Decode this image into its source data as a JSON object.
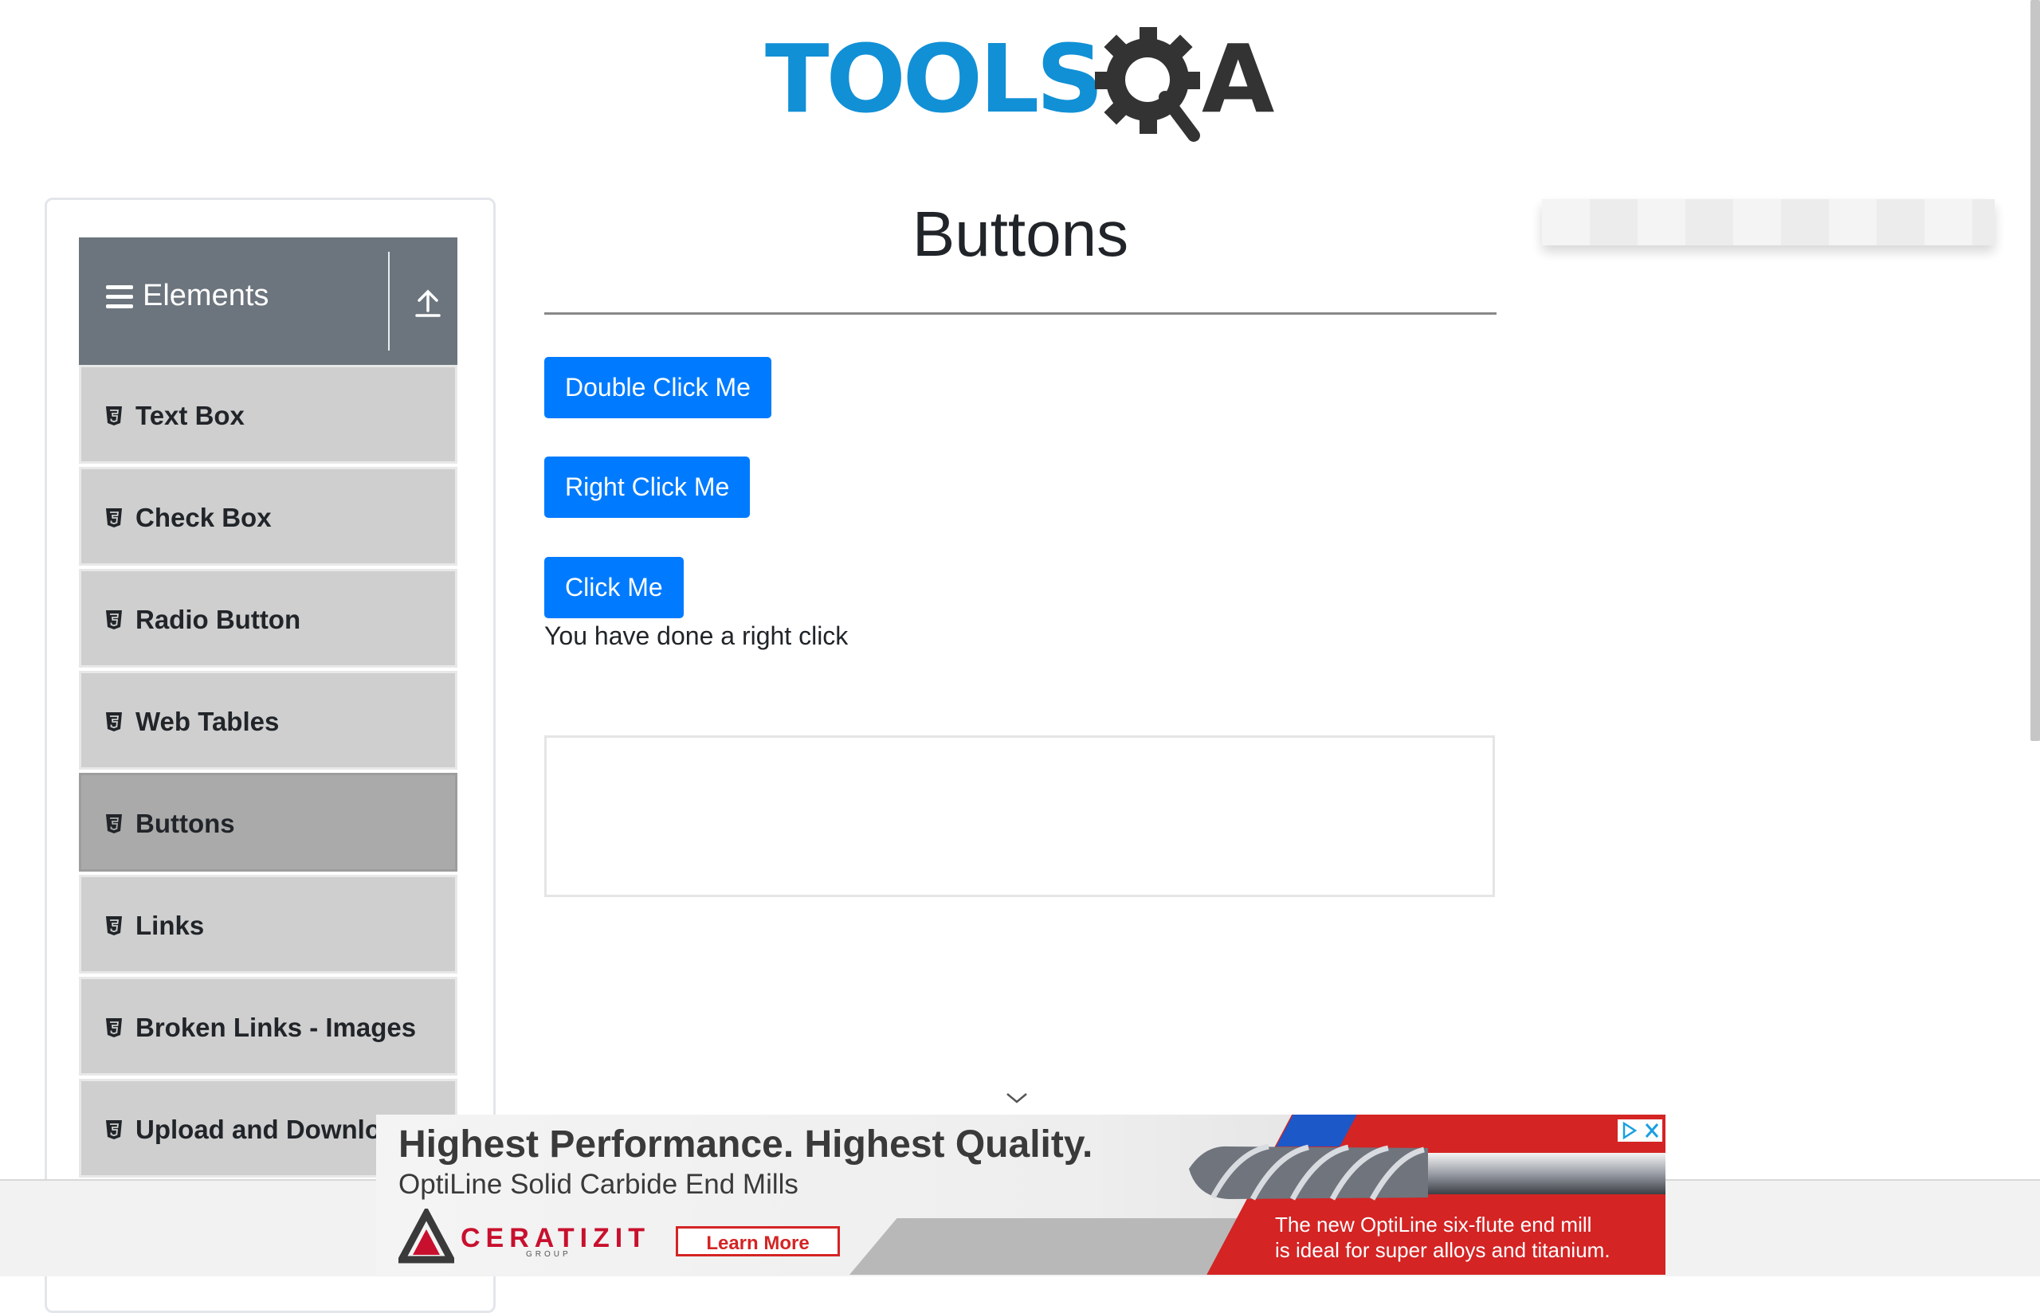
{
  "logo": {
    "part1": "TOOLS",
    "part2": "A"
  },
  "sidebar": {
    "group_title": "Elements",
    "items": [
      {
        "label": "Text Box",
        "active": false
      },
      {
        "label": "Check Box",
        "active": false
      },
      {
        "label": "Radio Button",
        "active": false
      },
      {
        "label": "Web Tables",
        "active": false
      },
      {
        "label": "Buttons",
        "active": true
      },
      {
        "label": "Links",
        "active": false
      },
      {
        "label": "Broken Links - Images",
        "active": false
      },
      {
        "label": "Upload and Download",
        "active": false
      }
    ]
  },
  "main": {
    "title": "Buttons",
    "double_click_label": "Double Click Me",
    "right_click_label": "Right Click Me",
    "click_label": "Click Me",
    "result_message": "You have done a right click"
  },
  "ad": {
    "headline": "Highest Performance. Highest Quality.",
    "subheadline": "OptiLine Solid Carbide End Mills",
    "brand": "CERATIZIT",
    "brand_group": "GROUP",
    "cta": "Learn More",
    "tagline_line1": "The new OptiLine six-flute end mill",
    "tagline_line2": "is ideal for super alloys and titanium."
  },
  "colors": {
    "primary": "#007bff",
    "logo_blue": "#1190d6",
    "sidebar_header": "#6c757d",
    "ad_red": "#d42424"
  }
}
